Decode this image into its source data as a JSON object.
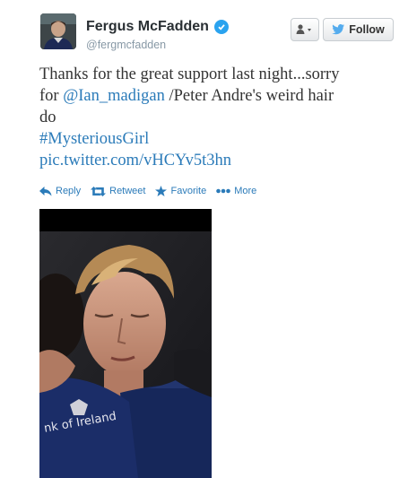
{
  "user": {
    "display_name": "Fergus McFadden",
    "handle": "@fergmcfadden"
  },
  "header_buttons": {
    "follow_label": "Follow"
  },
  "tweet": {
    "line1": "Thanks for the great support last night...sorry",
    "line2_prefix": "for ",
    "mention": "@Ian_madigan",
    "line2_suffix": " /Peter Andre's weird hair",
    "line3": "do",
    "hashtag": "#MysteriousGirl",
    "pic_link": "pic.twitter.com/vHCYv5t3hn"
  },
  "actions": {
    "reply": "Reply",
    "retweet": "Retweet",
    "favorite": "Favorite",
    "more": "More"
  },
  "photo": {
    "jersey_text": "nk of Ireland"
  },
  "colors": {
    "link": "#2b7bb9",
    "verified": "#2aa3ef",
    "text": "#333333",
    "muted": "#8899a6"
  }
}
